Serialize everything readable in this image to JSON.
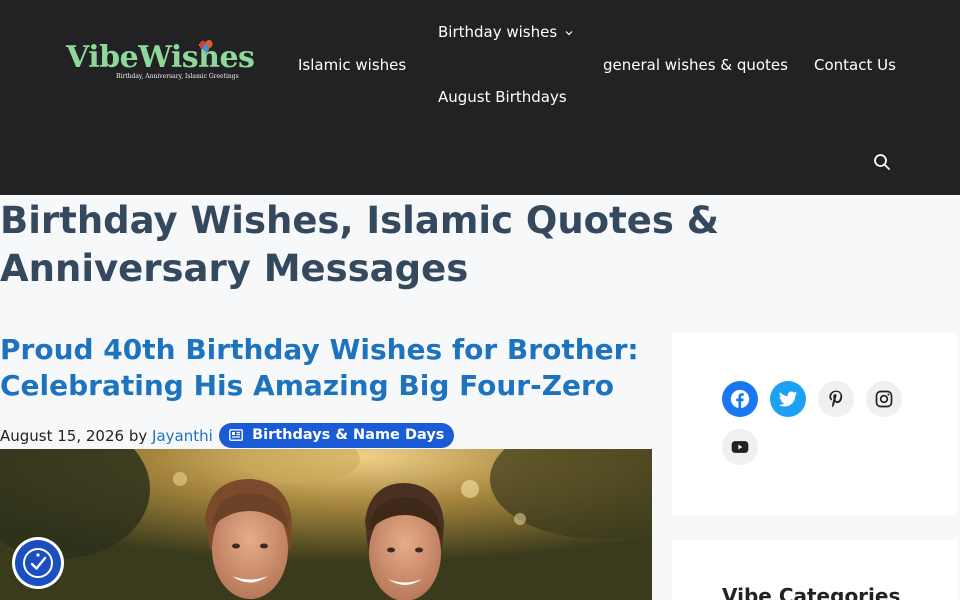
{
  "header": {
    "logo": {
      "name": "VibeWishes",
      "tagline": "Birthday, Anniversary, Islamic Greetings"
    },
    "nav": {
      "islamic": "Islamic wishes",
      "birthday": "Birthday wishes",
      "august": "August Birthdays",
      "general": "general wishes & quotes",
      "contact": "Contact Us"
    },
    "icons": {
      "search": "search-icon",
      "dropdown": "chevron-down-icon"
    }
  },
  "site_title": "Birthday Wishes, Islamic Quotes & Anniversary Messages",
  "article": {
    "title": "Proud 40th Birthday Wishes for Brother: Celebrating His Amazing Big Four-Zero",
    "date": "August 15, 2026",
    "by": "by",
    "author": "Jayanthi",
    "category": "Birthdays & Name Days",
    "category_icon": "newspaper-icon"
  },
  "sidebar": {
    "social": [
      "facebook-icon",
      "twitter-icon",
      "pinterest-icon",
      "instagram-icon",
      "youtube-icon"
    ],
    "categories_title": "Vibe Categories"
  },
  "accessibility": {
    "icon": "accessibility-icon"
  },
  "colors": {
    "header_bg": "#222224",
    "title": "#34495e",
    "link": "#1e73be",
    "pill": "#1a5bd6",
    "facebook": "#1877f2",
    "twitter": "#1da1f2",
    "logo_green": "#8ed99a"
  }
}
